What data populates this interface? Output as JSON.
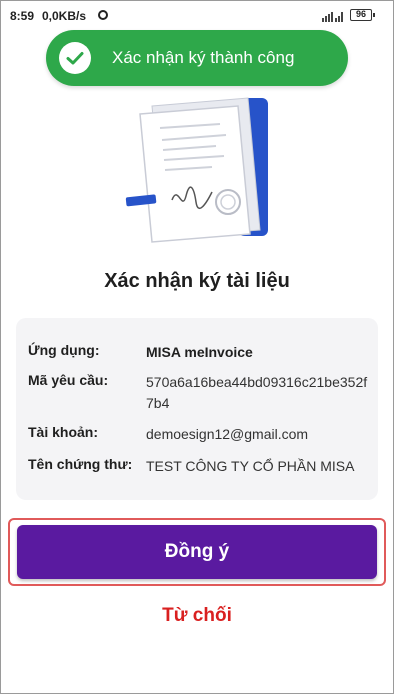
{
  "status_bar": {
    "time": "8:59",
    "speed": "0,0KB/s",
    "battery": "96"
  },
  "toast": {
    "message": "Xác nhận ký thành công",
    "color": "#2ea84a"
  },
  "page": {
    "title": "Xác nhận ký tài liệu"
  },
  "info": {
    "rows": [
      {
        "label": "Ứng dụng:",
        "value": "MISA meInvoice"
      },
      {
        "label": "Mã yêu cầu:",
        "value": "570a6a16bea44bd09316c21be352f7b4"
      },
      {
        "label": "Tài khoản:",
        "value": "demoesign12@gmail.com"
      },
      {
        "label": "Tên chứng thư:",
        "value": "TEST CÔNG TY CỔ PHẦN MISA"
      }
    ]
  },
  "actions": {
    "accept_label": "Đồng ý",
    "reject_label": "Từ chối",
    "accept_color": "#5a1aa0",
    "reject_color": "#d92020"
  },
  "icons": {
    "toast": "check-icon",
    "illustration": "document-signature-icon"
  }
}
